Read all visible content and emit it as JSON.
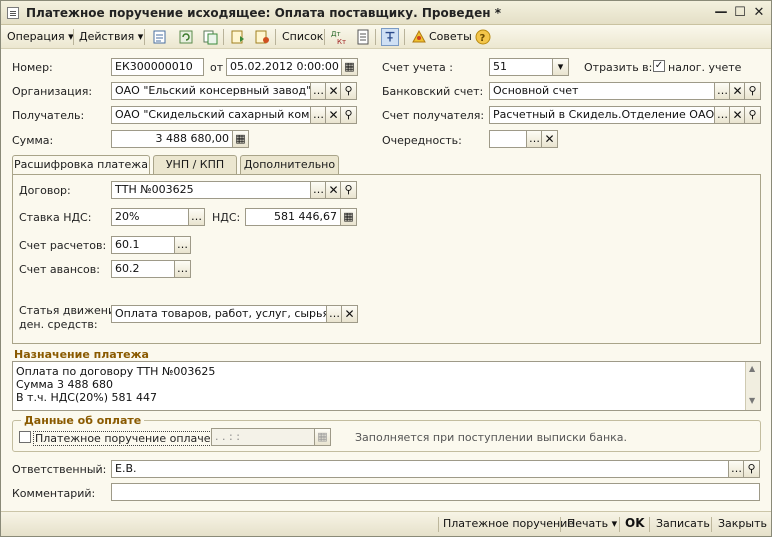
{
  "window": {
    "title": "Платежное поручение исходящее: Оплата поставщику. Проведен *",
    "min_glyph": "—",
    "max_glyph": "☐",
    "close_glyph": "✕"
  },
  "toolbar": {
    "operation": "Операция ▾",
    "actions": "Действия ▾",
    "list": "Список",
    "tips": "Советы",
    "dtkt": "Дт Кт"
  },
  "form": {
    "number_label": "Номер:",
    "number_value": "ЕК300000010",
    "from_label": "от",
    "date_value": "05.02.2012  0:00:00",
    "account_label": "Счет учета :",
    "account_value": "51",
    "reflect_label": "Отразить в:",
    "tax_label": "налог. учете",
    "tax_checked": "✓",
    "org_label": "Организация:",
    "org_value": "ОАО \"Ельский консервный завод\"",
    "bank_label": "Банковский счет:",
    "bank_value": "Основной счет",
    "recipient_label": "Получатель:",
    "recipient_value": "ОАО \"Скидельский сахарный комбина",
    "recipient_account_label": "Счет получателя:",
    "recipient_account_value": "Расчетный в Скидель.Отделение ОАО \"Бел",
    "sum_label": "Сумма:",
    "sum_value": "3 488 680,00",
    "priority_label": "Очередность:",
    "priority_value": ""
  },
  "tabs": [
    "Расшифровка платежа",
    "УНП / КПП",
    "Дополнительно"
  ],
  "payment": {
    "contract_label": "Договор:",
    "contract_value": "ТТН №003625",
    "vat_rate_label": "Ставка НДС:",
    "vat_rate_value": "20%",
    "vat_label": "НДС:",
    "vat_value": "581 446,67",
    "settle_label": "Счет расчетов:",
    "settle_value": "60.1",
    "advance_label": "Счет авансов:",
    "advance_value": "60.2",
    "cashflow_label1": "Статья движения",
    "cashflow_label2": "ден. средств:",
    "cashflow_value": "Оплата товаров, работ, услуг, сырья и ин"
  },
  "purpose": {
    "title": "Назначение платежа",
    "lines": [
      "Оплата по договору ТТН №003625",
      "Сумма 3 488 680",
      "В т.ч. НДС(20%) 581 447"
    ]
  },
  "paid": {
    "title": "Данные об оплате",
    "checkbox_label": "Платежное поручение оплачено:",
    "date_value": " .  .     :  :",
    "hint": "Заполняется при поступлении выписки банка."
  },
  "responsible": {
    "label": "Ответственный:",
    "value": "Е.В."
  },
  "comment": {
    "label": "Комментарий:",
    "value": ""
  },
  "statusbar": {
    "print_form": "Платежное поручение",
    "print": "Печать ▾",
    "ok": "OK",
    "save": "Записать",
    "close": "Закрыть"
  },
  "colors": {
    "accent": "#8a5a00",
    "window_bg": "#fbf9ee"
  }
}
